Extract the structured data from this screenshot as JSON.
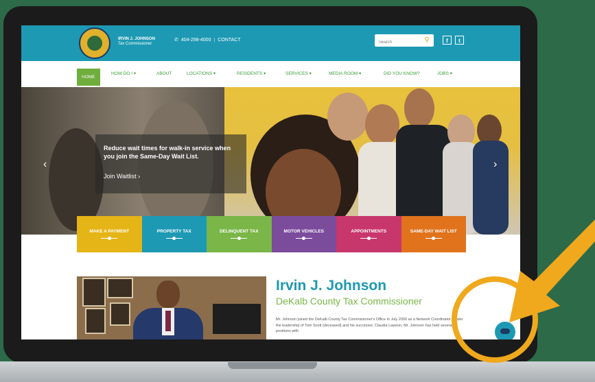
{
  "header": {
    "brand_line1": "IRVIN J. JOHNSON",
    "brand_line2": "Tax Commissioner",
    "phone": "404-298-4000",
    "contact": "CONTACT",
    "search_placeholder": "Search",
    "facebook": "f",
    "twitter": "t"
  },
  "nav": {
    "items": [
      "HOME",
      "HOW DO I ▾",
      "ABOUT",
      "LOCATIONS ▾",
      "RESIDENTS ▾",
      "SERVICES ▾",
      "MEDIA ROOM ▾",
      "DID YOU KNOW?",
      "JOBS ▾"
    ]
  },
  "hero": {
    "headline": "Reduce wait times for walk-in service when you join the Same-Day Wait List.",
    "link": "Join Waitlist  ›",
    "prev": "‹",
    "next": "›"
  },
  "tiles": [
    {
      "label": "MAKE A PAYMENT",
      "color": "#e5b416"
    },
    {
      "label": "PROPERTY TAX",
      "color": "#1d99b3"
    },
    {
      "label": "DELINQUENT TAX",
      "color": "#7ab648"
    },
    {
      "label": "MOTOR VEHICLES",
      "color": "#7b4b9c"
    },
    {
      "label": "APPOINTMENTS",
      "color": "#c8376b"
    },
    {
      "label": "SAME-DAY WAIT LIST",
      "color": "#e0731c"
    }
  ],
  "profile": {
    "name": "Irvin J. Johnson",
    "role": "DeKalb County Tax Commissioner",
    "bio": "Mr. Johnson joined the DeKalb County Tax Commissioner's Office in July 2000 as a Network Coordinator. Under the leadership of Tom Scott (deceased) and his successor, Claudia Lawson, Mr. Johnson has held several positions with"
  },
  "colors": {
    "brand_teal": "#1d99b3",
    "brand_green": "#7ab648",
    "highlight": "#f0a81c",
    "background": "#2d6a48"
  }
}
